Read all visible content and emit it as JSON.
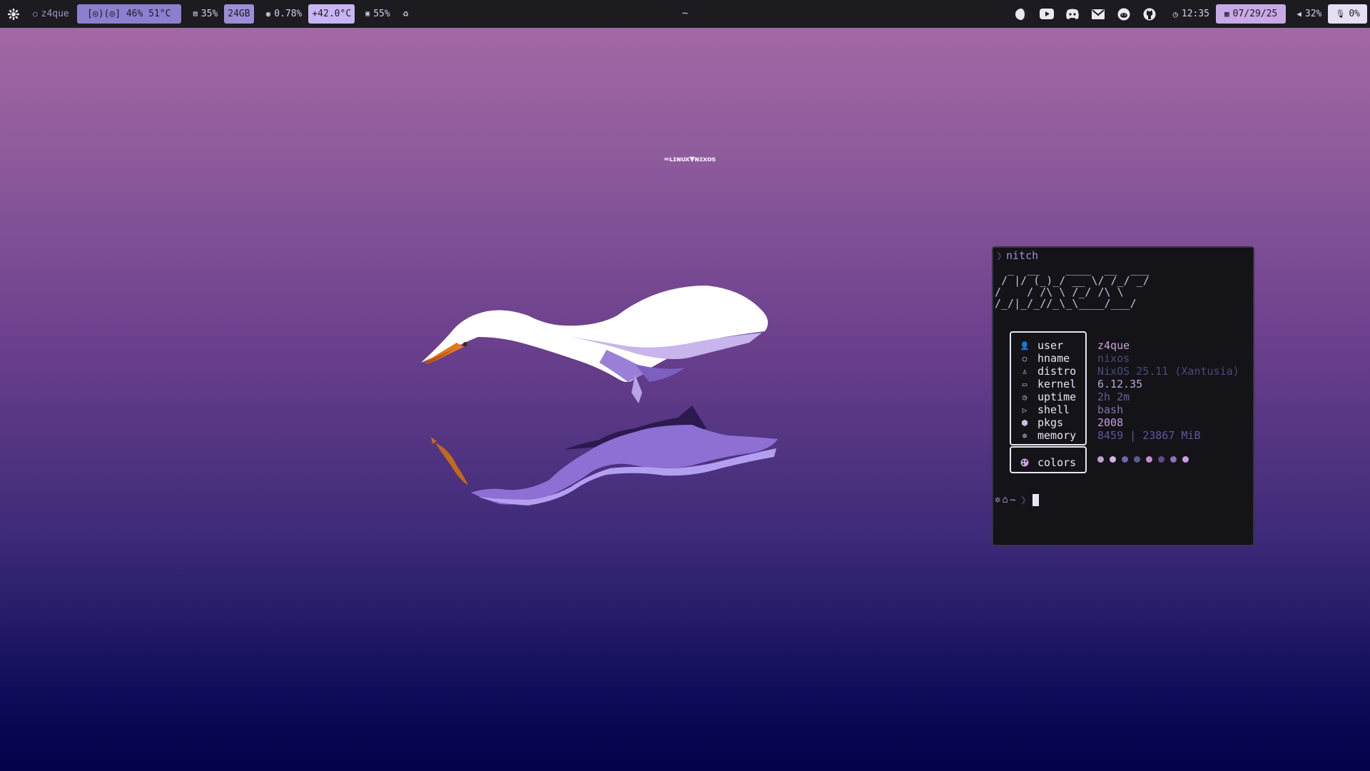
{
  "topbar": {
    "user": "z4que",
    "audio_viz": "[◎)(◎] 46% 51°C",
    "cpu_pct": "35%",
    "ram": "24GB",
    "gpu_pct": "0.78%",
    "temp": "+42.0°C",
    "disk": "55%",
    "title": "~",
    "clock": "12:35",
    "date": "07/29/25",
    "volume": "32%",
    "mic": "0%",
    "apps": [
      "browser-icon",
      "youtube-icon",
      "discord-icon",
      "mail-icon",
      "reddit-icon",
      "github-icon"
    ]
  },
  "wallpaper": {
    "label": "≈ʟɪɴᴜx▼ɴɪxᴏs"
  },
  "terminal": {
    "command": "nitch",
    "logo": "  _  __    ____  __  ___\n / |/ (_)_/ __ \\/ /_/ _/\n/    / /\\ \\ /_/ /\\ \\ \n/_/|_/_//_\\_\\____/___/",
    "info": [
      {
        "key": "user",
        "value": "z4que",
        "color": "#c9a0dc",
        "icon": "user-icon"
      },
      {
        "key": "hname",
        "value": "nixos",
        "color": "#4c4a7a",
        "icon": "host-icon"
      },
      {
        "key": "distro",
        "value": "NixOS 25.11 (Xantusia)",
        "color": "#4c4a7a",
        "icon": "tux-icon"
      },
      {
        "key": "kernel",
        "value": "6.12.35",
        "color": "#b9a5d6",
        "icon": "laptop-icon"
      },
      {
        "key": "uptime",
        "value": "2h 2m",
        "color": "#6a5f9a",
        "icon": "clock-icon"
      },
      {
        "key": "shell",
        "value": "bash",
        "color": "#8a6fa8",
        "icon": "terminal-icon"
      },
      {
        "key": "pkgs",
        "value": "2008",
        "color": "#c9a0dc",
        "icon": "box-icon"
      },
      {
        "key": "memory",
        "value": "8459 | 23867 MiB",
        "color": "#5b58a0",
        "icon": "chip-icon"
      }
    ],
    "colors_label": "colors",
    "palette": [
      "#b8a2d2",
      "#d3b0e6",
      "#7464a6",
      "#5c5b8f",
      "#c58bd0",
      "#5c4a8a",
      "#8c72b6",
      "#d29ae6"
    ],
    "prompt_dir": "~"
  }
}
